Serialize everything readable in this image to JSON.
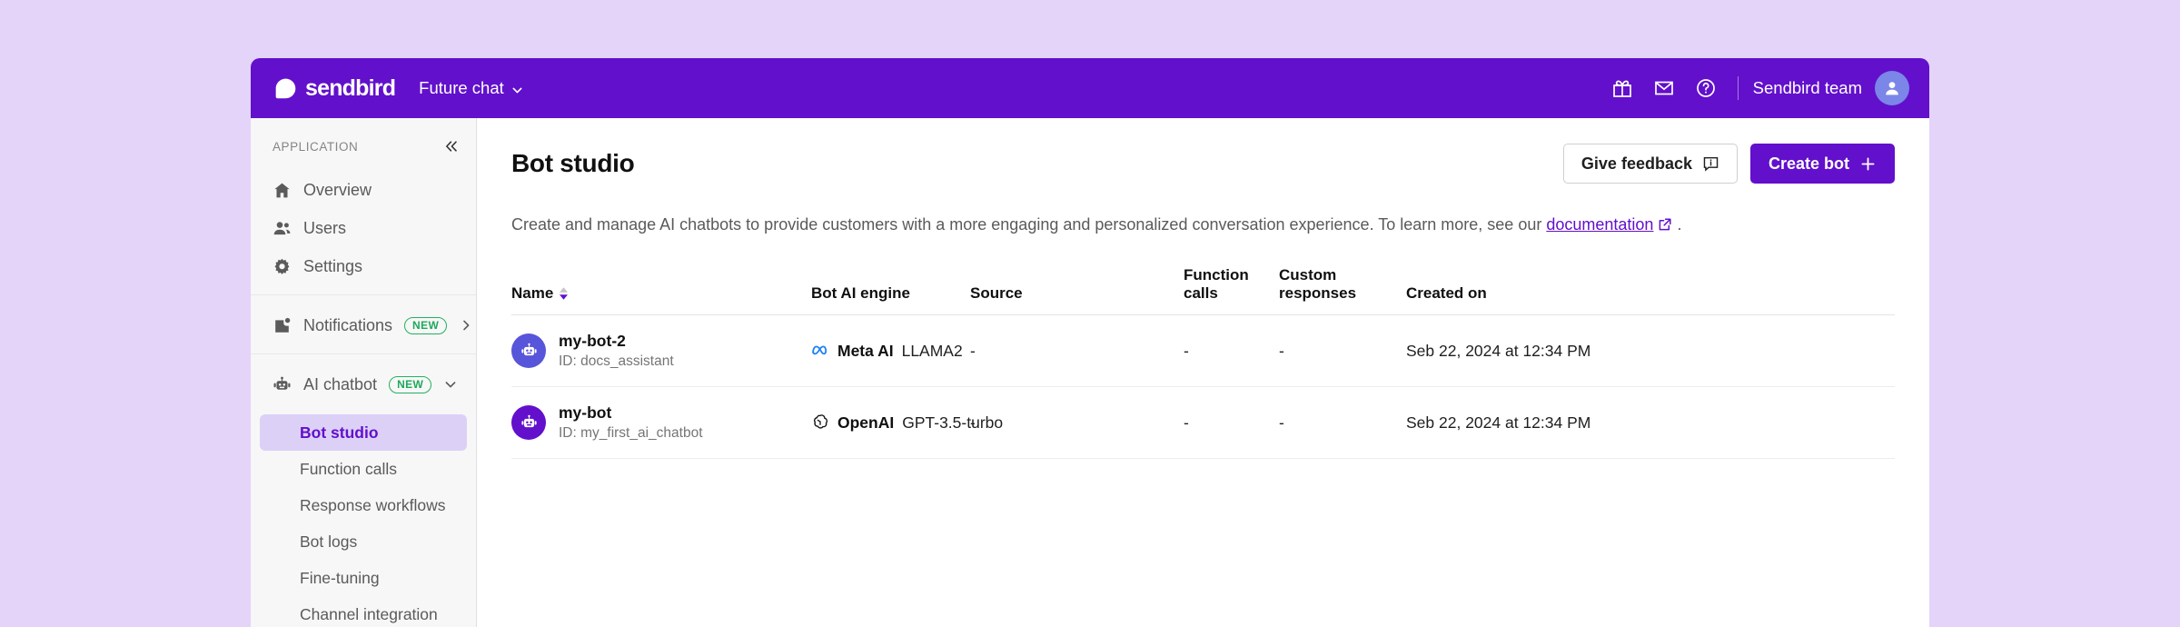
{
  "topbar": {
    "brand_word": "sendbird",
    "brand_logo_icon": "sendbird-logo-icon",
    "app_switcher_label": "Future chat",
    "app_switcher_icon": "chevron-down-icon",
    "icons": [
      {
        "name": "gift-icon",
        "label": "Gift"
      },
      {
        "name": "mail-icon",
        "label": "Mail"
      },
      {
        "name": "help-circle-icon",
        "label": "Help"
      }
    ],
    "team_name": "Sendbird team",
    "avatar_icon": "user-avatar-icon",
    "bg_color": "#6210cc"
  },
  "sidebar": {
    "caption": "APPLICATION",
    "collapse_icon": "chevron-double-left-icon",
    "group_one": [
      {
        "label": "Overview",
        "icon": "home-icon"
      },
      {
        "label": "Users",
        "icon": "users-icon"
      },
      {
        "label": "Settings",
        "icon": "gear-icon"
      }
    ],
    "notifications": {
      "label": "Notifications",
      "icon": "notification-icon",
      "badge": "NEW",
      "trail_icon": "chevron-right-icon"
    },
    "ai_chatbot": {
      "label": "AI chatbot",
      "icon": "robot-icon",
      "badge": "NEW",
      "trail_icon": "chevron-down-icon"
    },
    "sub_items": [
      {
        "label": "Bot studio",
        "active": true
      },
      {
        "label": "Function calls",
        "active": false
      },
      {
        "label": "Response workflows",
        "active": false
      },
      {
        "label": "Bot logs",
        "active": false
      },
      {
        "label": "Fine-tuning",
        "active": false
      },
      {
        "label": "Channel integration",
        "active": false
      }
    ],
    "badge_color": "#23b05f",
    "active_bg": "#dcd0f7",
    "active_color": "#6210cc"
  },
  "main": {
    "page_title": "Bot studio",
    "give_feedback_label": "Give feedback",
    "give_feedback_icon": "feedback-info-icon",
    "create_bot_label": "Create bot",
    "create_bot_icon": "plus-icon",
    "description_before": "Create and manage AI chatbots to provide customers with a more engaging and personalized conversation experience. To learn more, see our ",
    "description_link": "documentation",
    "description_link_icon": "external-link-icon",
    "description_after": " ."
  },
  "table": {
    "columns": [
      {
        "label": "Name",
        "sortable": true,
        "sort_icon": "sort-arrows-icon"
      },
      {
        "label": "Bot AI engine",
        "sortable": false
      },
      {
        "label": "Source",
        "sortable": false
      },
      {
        "label": "Function calls",
        "sortable": false
      },
      {
        "label": "Custom responses",
        "sortable": false
      },
      {
        "label": "Created on",
        "sortable": false
      }
    ],
    "rows": [
      {
        "avatar_icon": "robot-avatar-icon",
        "avatar_color": "#5755d9",
        "name": "my-bot-2",
        "id": "ID: docs_assistant",
        "engine_icon": "meta-ai-icon",
        "engine_vendor": "Meta AI",
        "engine_model": " LLAMA2",
        "source": "-",
        "function_calls": "-",
        "custom_responses": "-",
        "created_on": "Seb 22, 2024 at 12:34 PM"
      },
      {
        "avatar_icon": "robot-avatar-icon",
        "avatar_color": "#6210cc",
        "name": "my-bot",
        "id": "ID: my_first_ai_chatbot",
        "engine_icon": "openai-icon",
        "engine_vendor": "OpenAI",
        "engine_model": " GPT-3.5-turbo",
        "source": "-",
        "function_calls": "-",
        "custom_responses": "-",
        "created_on": "Seb 22, 2024 at 12:34 PM"
      }
    ]
  }
}
